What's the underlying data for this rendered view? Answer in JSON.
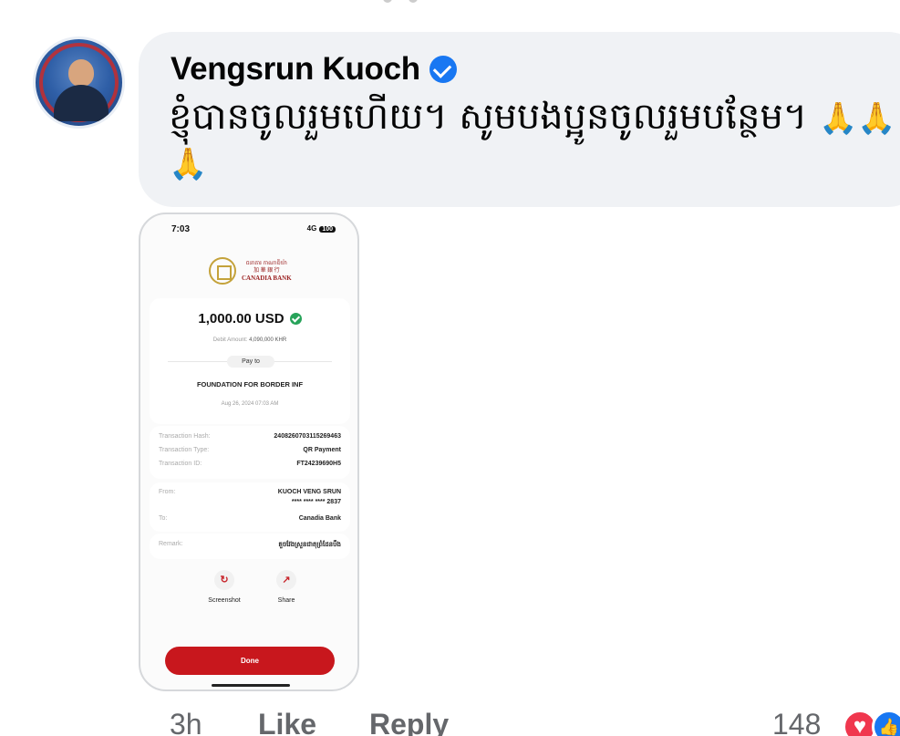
{
  "comment": {
    "author": "Vengsrun Kuoch",
    "text": "ខ្ញុំបានចូលរួមហើយ។ សូមបងប្អូនចូលរួមបន្ថែម។",
    "emoji": "🙏🙏🙏"
  },
  "receipt": {
    "status_time": "7:03",
    "status_signal": "4G",
    "status_battery": "100",
    "bank_name_kh": "ធនាគារ កាណាឌីយ៉ា",
    "bank_name_cn": "加 華 銀 行",
    "bank_name_en": "CANADIA BANK",
    "amount": "1,000.00 USD",
    "debit_label": "Debit Amount:",
    "debit_value": "4,090,000 KHR",
    "pay_to": "Pay to",
    "payee": "FOUNDATION FOR BORDER INF",
    "date": "Aug 26, 2024 07:03 AM",
    "transaction_hash_label": "Transaction Hash:",
    "transaction_hash": "2408260703115269463",
    "transaction_type_label": "Transaction Type:",
    "transaction_type": "QR Payment",
    "transaction_id_label": "Transaction ID:",
    "transaction_id": "FT24239690H5",
    "from_label": "From:",
    "from_name": "KUOCH VENG SRUN",
    "from_account": "**** **** **** 2837",
    "to_label": "To:",
    "to_value": "Canadia Bank",
    "remark_label": "Remark:",
    "remark_value": "គួចវែងស្រួនជាតុព្រំដែនបឹង",
    "screenshot_label": "Screenshot",
    "share_label": "Share",
    "done_label": "Done"
  },
  "footer": {
    "timestamp": "3h",
    "like_label": "Like",
    "reply_label": "Reply",
    "reaction_count": "148"
  },
  "colors": {
    "bubble": "#f0f2f5",
    "verified": "#1877f2",
    "done_button": "#c8171d",
    "heart_reaction": "#f0374e",
    "like_reaction": "#1877f2"
  }
}
